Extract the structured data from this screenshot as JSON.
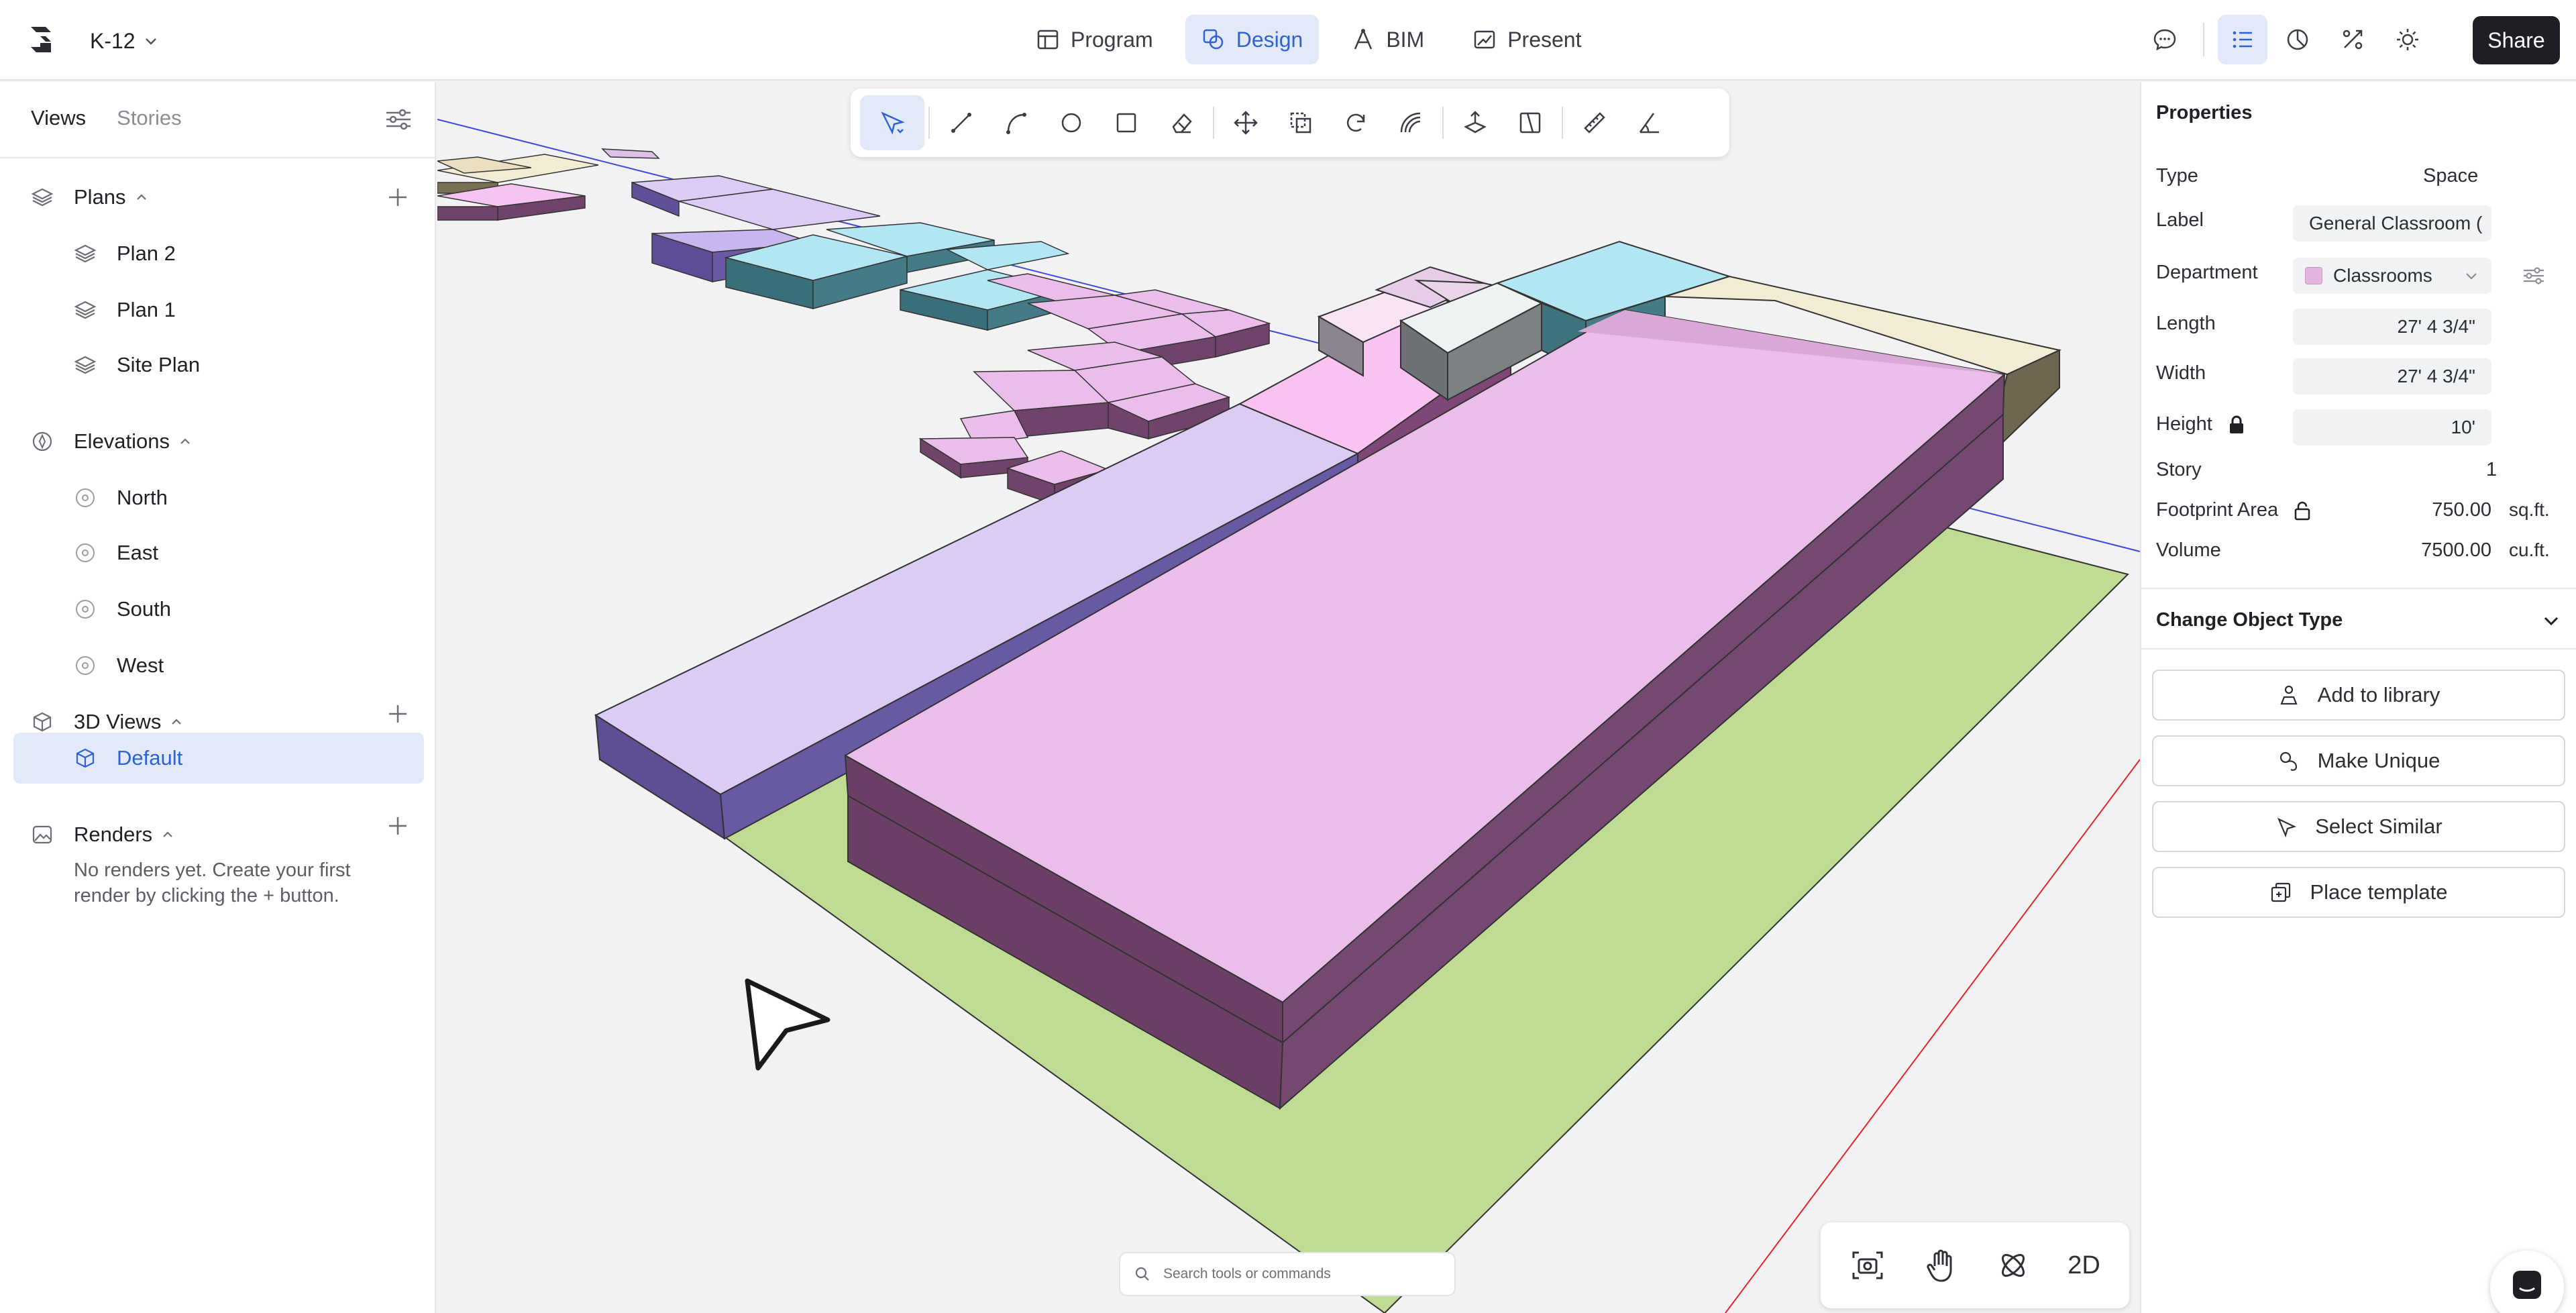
{
  "app": {
    "project_name": "K-12",
    "share_label": "Share",
    "nav_tabs": [
      {
        "label": "Program",
        "icon": "table-icon",
        "active": false
      },
      {
        "label": "Design",
        "icon": "design-icon",
        "active": true
      },
      {
        "label": "BIM",
        "icon": "bim-icon",
        "active": false
      },
      {
        "label": "Present",
        "icon": "present-icon",
        "active": false
      }
    ],
    "right_icons": [
      "comment-icon",
      "list-icon",
      "chart-icon",
      "tools-icon",
      "theme-icon"
    ]
  },
  "left_panel": {
    "tabs": [
      {
        "label": "Views",
        "active": true
      },
      {
        "label": "Stories",
        "active": false
      }
    ],
    "sections": [
      {
        "label": "Plans",
        "items": [
          "Plan 2",
          "Plan 1",
          "Site Plan"
        ]
      },
      {
        "label": "Elevations",
        "items": [
          "North",
          "East",
          "South",
          "West"
        ]
      },
      {
        "label": "3D Views",
        "items": [
          "Default"
        ],
        "selected": "Default"
      },
      {
        "label": "Renders",
        "empty_text": "No renders yet. Create your first render by clicking the + button."
      }
    ]
  },
  "viewport": {
    "toolbar_tools": [
      "select-icon",
      "line-icon",
      "arc-icon",
      "circle-icon",
      "rectangle-icon",
      "eraser-icon",
      "move-icon",
      "copy-icon",
      "rotate-icon",
      "offset-icon",
      "push-pull-icon",
      "split-icon",
      "measure-icon",
      "angle-icon"
    ],
    "search_placeholder": "Search tools or commands",
    "view_tools": {
      "mode_label": "2D"
    },
    "colors": {
      "site": "#c0dc94",
      "lavender": "#dcccf5",
      "pink": "#f9c2f1",
      "magenta": "#ebbdea",
      "cyan": "#b1e6f2",
      "cream": "#f3ecd4",
      "white_block": "#eef2f2",
      "light_pink": "#f8e3f4"
    }
  },
  "properties": {
    "title": "Properties",
    "type_label": "Type",
    "type_value": "Space",
    "label_label": "Label",
    "label_value": "General Classroom (",
    "department_label": "Department",
    "department_value": "Classrooms",
    "department_color": "#e3b5df",
    "length_label": "Length",
    "length_value": "27' 4 3/4\"",
    "width_label": "Width",
    "width_value": "27' 4 3/4\"",
    "height_label": "Height",
    "height_value": "10'",
    "story_label": "Story",
    "story_value": "1",
    "footprint_label": "Footprint Area",
    "footprint_value": "750.00",
    "footprint_unit": "sq.ft.",
    "volume_label": "Volume",
    "volume_value": "7500.00",
    "volume_unit": "cu.ft.",
    "change_type_label": "Change Object Type",
    "actions": [
      {
        "label": "Add to library",
        "icon": "library-add-icon"
      },
      {
        "label": "Make Unique",
        "icon": "make-unique-icon"
      },
      {
        "label": "Select Similar",
        "icon": "select-similar-icon"
      },
      {
        "label": "Place template",
        "icon": "place-template-icon"
      }
    ]
  }
}
